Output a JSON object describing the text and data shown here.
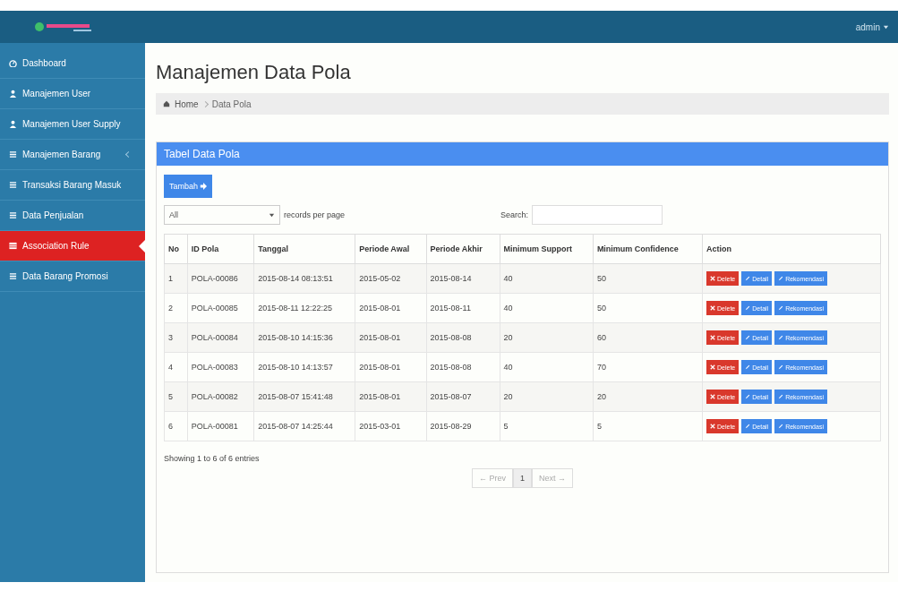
{
  "topbar": {
    "user": "admin"
  },
  "sidebar": {
    "items": [
      {
        "label": "Dashboard",
        "kind": "dashboard",
        "selected": false
      },
      {
        "label": "Manajemen User",
        "kind": "user",
        "selected": false
      },
      {
        "label": "Manajemen User Supply",
        "kind": "user",
        "selected": false
      },
      {
        "label": "Manajemen Barang",
        "kind": "list",
        "selected": false,
        "expandable": true
      },
      {
        "label": "Transaksi Barang Masuk",
        "kind": "list",
        "selected": false
      },
      {
        "label": "Data Penjualan",
        "kind": "list",
        "selected": false
      },
      {
        "label": "Association Rule",
        "kind": "table",
        "selected": true
      },
      {
        "label": "Data Barang Promosi",
        "kind": "list",
        "selected": false
      }
    ]
  },
  "page": {
    "title": "Manajemen Data Pola",
    "breadcrumb": [
      "Home",
      "Data Pola"
    ]
  },
  "panel": {
    "title": "Tabel Data Pola",
    "add_button": "Tambah",
    "page_size": "All",
    "page_size_label": "records per page",
    "search_label": "Search:",
    "table": {
      "columns": [
        "No",
        "ID Pola",
        "Tanggal",
        "Periode Awal",
        "Periode Akhir",
        "Minimum Support",
        "Minimum Confidence",
        "Action"
      ],
      "rows": [
        {
          "cells": [
            "1",
            "POLA-00086",
            "2015-08-14 08:13:51",
            "2015-05-02",
            "2015-08-14",
            "40",
            "50"
          ],
          "actions": [
            {
              "label": "Delete",
              "kind": "danger"
            },
            {
              "label": "Detail",
              "kind": "primary"
            },
            {
              "label": "Rekomendasi",
              "kind": "primary"
            }
          ]
        },
        {
          "cells": [
            "2",
            "POLA-00085",
            "2015-08-11 12:22:25",
            "2015-08-01",
            "2015-08-11",
            "40",
            "50"
          ],
          "actions": [
            {
              "label": "Delete",
              "kind": "danger"
            },
            {
              "label": "Detail",
              "kind": "primary"
            },
            {
              "label": "Rekomendasi",
              "kind": "primary"
            }
          ]
        },
        {
          "cells": [
            "3",
            "POLA-00084",
            "2015-08-10 14:15:36",
            "2015-08-01",
            "2015-08-08",
            "20",
            "60"
          ],
          "actions": [
            {
              "label": "Delete",
              "kind": "danger"
            },
            {
              "label": "Detail",
              "kind": "primary"
            },
            {
              "label": "Rekomendasi",
              "kind": "primary"
            }
          ]
        },
        {
          "cells": [
            "4",
            "POLA-00083",
            "2015-08-10 14:13:57",
            "2015-08-01",
            "2015-08-08",
            "40",
            "70"
          ],
          "actions": [
            {
              "label": "Delete",
              "kind": "danger"
            },
            {
              "label": "Detail",
              "kind": "primary"
            },
            {
              "label": "Rekomendasi",
              "kind": "primary"
            }
          ]
        },
        {
          "cells": [
            "5",
            "POLA-00082",
            "2015-08-07 15:41:48",
            "2015-08-01",
            "2015-08-07",
            "20",
            "20"
          ],
          "actions": [
            {
              "label": "Delete",
              "kind": "danger"
            },
            {
              "label": "Detail",
              "kind": "primary"
            },
            {
              "label": "Rekomendasi",
              "kind": "primary"
            }
          ]
        },
        {
          "cells": [
            "6",
            "POLA-00081",
            "2015-08-07 14:25:44",
            "2015-03-01",
            "2015-08-29",
            "5",
            "5"
          ],
          "actions": [
            {
              "label": "Delete",
              "kind": "danger"
            },
            {
              "label": "Detail",
              "kind": "primary"
            },
            {
              "label": "Rekomendasi",
              "kind": "primary"
            }
          ]
        }
      ]
    },
    "info": "Showing 1 to 6 of 6 entries",
    "pagination": [
      {
        "label": "← Prev",
        "selected": false,
        "disabled": true
      },
      {
        "label": "1",
        "selected": true,
        "disabled": false
      },
      {
        "label": "Next →",
        "selected": false,
        "disabled": true
      }
    ]
  }
}
